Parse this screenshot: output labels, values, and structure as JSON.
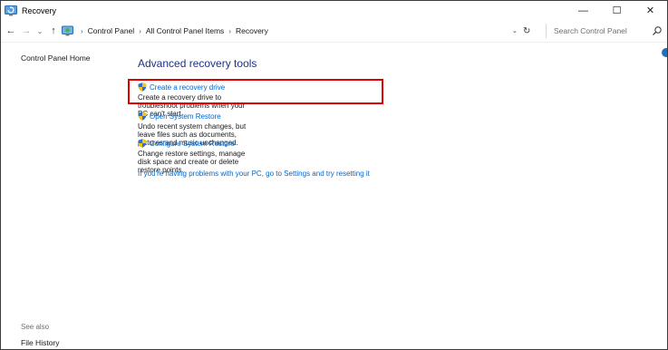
{
  "window": {
    "title": "Recovery",
    "minimize_glyph": "—",
    "maximize_glyph": "☐",
    "close_glyph": "✕"
  },
  "nav": {
    "back_glyph": "←",
    "forward_glyph": "→",
    "recent_glyph": "⌄",
    "up_glyph": "↑",
    "breadcrumb": [
      "Control Panel",
      "All Control Panel Items",
      "Recovery"
    ],
    "separator": "›",
    "dropdown_glyph": "⌄",
    "refresh_glyph": "↻"
  },
  "search": {
    "placeholder": "Search Control Panel"
  },
  "leftpane": {
    "home_link": "Control Panel Home",
    "see_also": "See also",
    "file_history": "File History"
  },
  "main": {
    "heading": "Advanced recovery tools",
    "tools": [
      {
        "label": "Create a recovery drive",
        "description": "Create a recovery drive to troubleshoot problems when your PC can't start."
      },
      {
        "label": "Open System Restore",
        "description": "Undo recent system changes, but leave files such as documents, pictures and music unchanged."
      },
      {
        "label": "Configure System Restore",
        "description": "Change restore settings, manage disk space and create or delete restore points."
      }
    ],
    "reset_link": "If you're having problems with your PC, go to Settings and try resetting it"
  },
  "colors": {
    "heading": "#1e3287",
    "link": "#0066cc",
    "highlight": "#e00000"
  },
  "icons": {
    "app": "recovery-app-icon",
    "shield": "uac-shield-icon",
    "search": "search-icon"
  }
}
